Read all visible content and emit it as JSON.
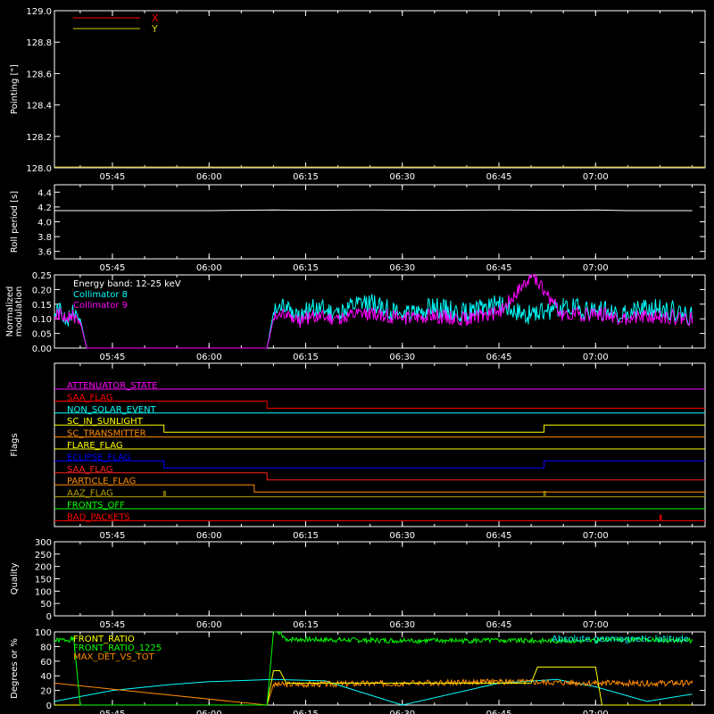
{
  "chart_data": [
    {
      "type": "line",
      "ylabel": "Pointing [\"]",
      "ylim": [
        128.0,
        129.0
      ],
      "yticks": [
        "128.0",
        "128.2",
        "128.4",
        "128.6",
        "128.8",
        "129.0"
      ],
      "xticks": [
        "05:45",
        "06:00",
        "06:15",
        "06:30",
        "06:45",
        "07:00"
      ],
      "series": [
        {
          "name": "X",
          "color": "#ff0000",
          "x": [],
          "y": []
        },
        {
          "name": "Y",
          "color": "#d2d200",
          "x": [],
          "y": []
        }
      ],
      "baseline_color": "#b4a000"
    },
    {
      "type": "line",
      "ylabel": "Roll period [s]",
      "ylim": [
        3.5,
        4.5
      ],
      "yticks": [
        "3.6",
        "3.8",
        "4.0",
        "4.2",
        "4.4"
      ],
      "xticks": [
        "05:45",
        "06:00",
        "06:15",
        "06:30",
        "06:45",
        "07:00"
      ],
      "series": [
        {
          "name": "",
          "color": "#ffffff",
          "x": [
            "05:36",
            "06:00",
            "06:10",
            "06:15",
            "06:25",
            "06:35",
            "06:45",
            "06:55",
            "07:00",
            "07:05",
            "07:15"
          ],
          "y": [
            4.15,
            4.15,
            4.16,
            4.155,
            4.16,
            4.155,
            4.16,
            4.155,
            4.16,
            4.15,
            4.15
          ]
        }
      ]
    },
    {
      "type": "line",
      "ylabel": "Normalized modulation",
      "ylim": [
        0.0,
        0.25
      ],
      "yticks": [
        "0.00",
        "0.05",
        "0.10",
        "0.15",
        "0.20",
        "0.25"
      ],
      "xticks": [
        "05:45",
        "06:00",
        "06:15",
        "06:30",
        "06:45",
        "07:00"
      ],
      "annotation": "Energy band: 12-25 keV",
      "series": [
        {
          "name": "Collimator 8",
          "color": "#00ffff",
          "x": [
            "05:36",
            "05:37",
            "05:38",
            "05:39",
            "05:40",
            "05:41",
            "06:09",
            "06:10",
            "06:12",
            "06:14",
            "06:16",
            "06:20",
            "06:25",
            "06:30",
            "06:35",
            "06:40",
            "06:45",
            "06:50",
            "06:55",
            "07:00",
            "07:05",
            "07:10",
            "07:15"
          ],
          "y": [
            0.11,
            0.13,
            0.09,
            0.12,
            0.1,
            0.0,
            0.0,
            0.12,
            0.15,
            0.1,
            0.14,
            0.12,
            0.16,
            0.11,
            0.14,
            0.12,
            0.15,
            0.11,
            0.14,
            0.13,
            0.12,
            0.14,
            0.11
          ]
        },
        {
          "name": "Collimator 9",
          "color": "#ff00ff",
          "x": [
            "05:36",
            "05:37",
            "05:38",
            "05:39",
            "05:40",
            "05:41",
            "06:09",
            "06:10",
            "06:12",
            "06:14",
            "06:16",
            "06:20",
            "06:25",
            "06:30",
            "06:35",
            "06:40",
            "06:45",
            "06:50",
            "06:55",
            "07:00",
            "07:05",
            "07:10",
            "07:15"
          ],
          "y": [
            0.1,
            0.12,
            0.1,
            0.11,
            0.09,
            0.0,
            0.0,
            0.1,
            0.12,
            0.09,
            0.11,
            0.1,
            0.12,
            0.1,
            0.11,
            0.1,
            0.12,
            0.25,
            0.11,
            0.12,
            0.1,
            0.11,
            0.1
          ]
        }
      ]
    },
    {
      "type": "line",
      "ylabel": "Flags",
      "xticks": [
        "05:45",
        "06:00",
        "06:15",
        "06:30",
        "06:45",
        "07:00"
      ],
      "flags": [
        {
          "name": "ATTENUATOR_STATE",
          "color": "#ff00ff",
          "steps": []
        },
        {
          "name": "SAA_FLAG",
          "color": "#ff0000",
          "steps": [
            "06:09"
          ]
        },
        {
          "name": "NON_SOLAR_EVENT",
          "color": "#00ffff",
          "steps": []
        },
        {
          "name": "SC_IN_SUNLIGHT",
          "color": "#ffff00",
          "steps": [
            "05:53",
            "06:52"
          ]
        },
        {
          "name": "SC_TRANSMITTER",
          "color": "#ff8c00",
          "steps": []
        },
        {
          "name": "FLARE_FLAG",
          "color": "#ffff00",
          "steps": []
        },
        {
          "name": "ECLIPSE_FLAG",
          "color": "#0000ff",
          "steps": [
            "05:53",
            "06:52"
          ]
        },
        {
          "name": "SAA_FLAG",
          "color": "#ff2020",
          "steps": [
            "06:09"
          ]
        },
        {
          "name": "PARTICLE_FLAG",
          "color": "#ff8c00",
          "steps": [
            "06:07"
          ]
        },
        {
          "name": "AAZ_FLAG",
          "color": "#b4a000",
          "pulses": [
            "05:53",
            "06:52"
          ]
        },
        {
          "name": "FRONTS_OFF",
          "color": "#00ff00",
          "steps": []
        },
        {
          "name": "BAD_PACKETS",
          "color": "#ff0000",
          "pulses": [
            "07:10"
          ]
        }
      ]
    },
    {
      "type": "line",
      "ylabel": "Quality",
      "ylim": [
        0,
        300
      ],
      "yticks": [
        "0",
        "50",
        "100",
        "150",
        "200",
        "250",
        "300"
      ],
      "xticks": [
        "05:45",
        "06:00",
        "06:15",
        "06:30",
        "06:45",
        "07:00"
      ],
      "series": []
    },
    {
      "type": "line",
      "ylabel": "Degrees or %",
      "ylim": [
        0,
        100
      ],
      "yticks": [
        "0",
        "20",
        "40",
        "60",
        "80",
        "100"
      ],
      "xticks": [
        "05:45",
        "06:00",
        "06:15",
        "06:30",
        "06:45",
        "07:00"
      ],
      "annotation": "Absolute geomagnetic latitude",
      "series": [
        {
          "name": "FRONT_RATIO",
          "color": "#ffff00",
          "x": [
            "05:36",
            "06:09",
            "06:10",
            "06:11",
            "06:12",
            "06:30",
            "06:50",
            "06:51",
            "07:00",
            "07:01",
            "07:15"
          ],
          "y": [
            0,
            0,
            47,
            47,
            30,
            30,
            30,
            52,
            52,
            0,
            0
          ]
        },
        {
          "name": "FRONT_RATIO_1225",
          "color": "#00ff00",
          "x": [
            "05:36",
            "05:39",
            "05:40",
            "06:09",
            "06:10",
            "06:11",
            "06:12",
            "06:30",
            "06:45",
            "07:00",
            "07:01",
            "07:15"
          ],
          "y": [
            88,
            90,
            0,
            0,
            100,
            100,
            90,
            88,
            88,
            88,
            90,
            88
          ]
        },
        {
          "name": "MAX_DET_VS_TOT",
          "color": "#ff8c00",
          "x": [
            "05:36",
            "06:09",
            "06:10",
            "06:30",
            "06:45",
            "07:00",
            "07:15"
          ],
          "y": [
            30,
            0,
            28,
            30,
            32,
            30,
            30
          ]
        },
        {
          "name": "",
          "color": "#00ffff",
          "x": [
            "05:36",
            "05:45",
            "05:54",
            "06:00",
            "06:10",
            "06:18",
            "06:30",
            "06:45",
            "06:54",
            "07:00",
            "07:08",
            "07:15"
          ],
          "y": [
            5,
            20,
            28,
            32,
            35,
            33,
            0,
            30,
            35,
            25,
            5,
            15
          ]
        }
      ]
    }
  ]
}
